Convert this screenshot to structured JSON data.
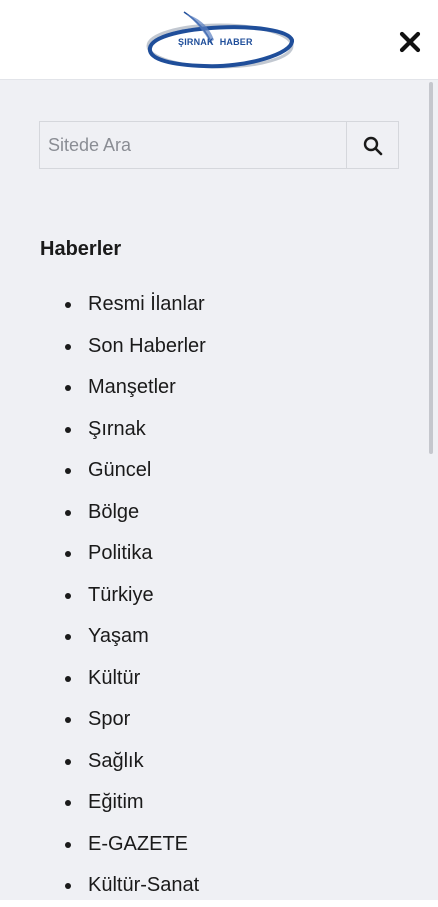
{
  "header": {
    "logo": {
      "word1": "ŞIRNAK",
      "word2": "HABER",
      "icon": "quill-icon",
      "colors": {
        "ring": "#1f4e9a",
        "shadow": "#9aa3b3"
      }
    },
    "close_icon": "close-icon"
  },
  "search": {
    "placeholder": "Sitede Ara",
    "value": "",
    "button_icon": "search-icon"
  },
  "menu": {
    "title": "Haberler",
    "items": [
      {
        "label": "Resmi İlanlar"
      },
      {
        "label": "Son Haberler"
      },
      {
        "label": "Manşetler"
      },
      {
        "label": "Şırnak"
      },
      {
        "label": "Güncel"
      },
      {
        "label": "Bölge"
      },
      {
        "label": "Politika"
      },
      {
        "label": "Türkiye"
      },
      {
        "label": "Yaşam"
      },
      {
        "label": "Kültür"
      },
      {
        "label": "Spor"
      },
      {
        "label": "Sağlık"
      },
      {
        "label": "Eğitim"
      },
      {
        "label": "E-GAZETE"
      },
      {
        "label": "Kültür-Sanat"
      }
    ]
  },
  "colors": {
    "panel_background": "#eff0f4",
    "text": "#1a1a1a",
    "border": "#d5d7dc"
  }
}
